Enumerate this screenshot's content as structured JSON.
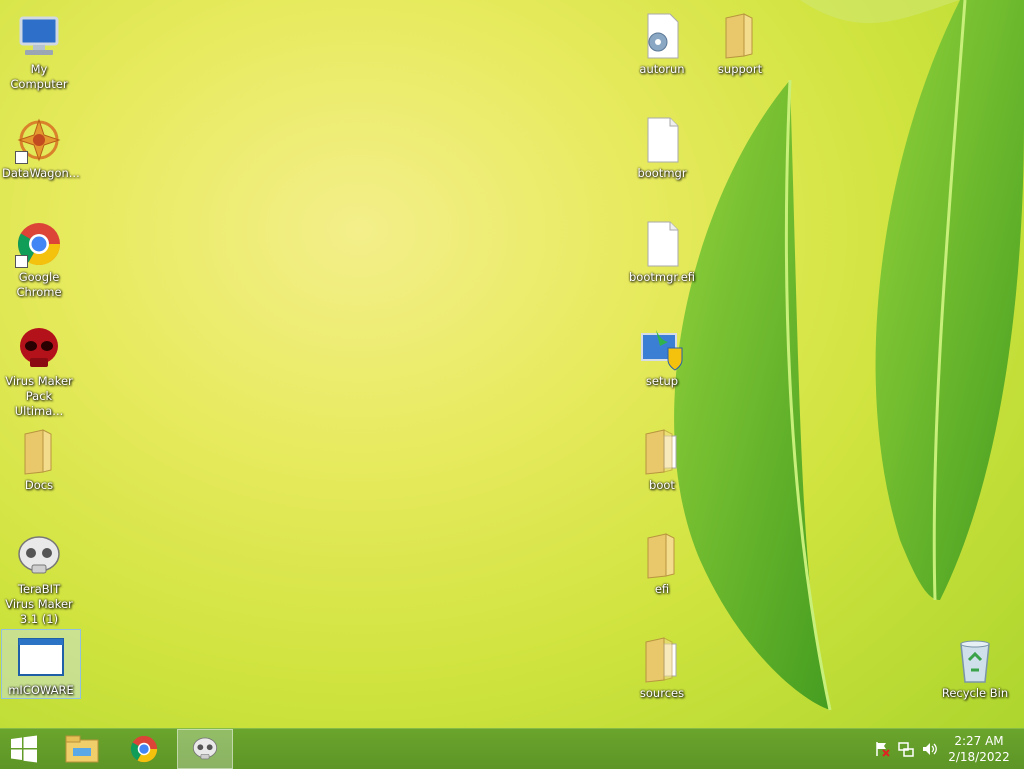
{
  "desktop": {
    "left_icons": [
      {
        "label": "My Computer",
        "icon": "computer-icon"
      },
      {
        "label": "DataWagon...",
        "icon": "datawagon-icon"
      },
      {
        "label": "Google Chrome",
        "icon": "chrome-icon"
      },
      {
        "label": "Virus Maker Pack Ultima...",
        "icon": "red-skull-icon"
      },
      {
        "label": "Docs",
        "icon": "folder-icon"
      },
      {
        "label": "TeraBIT Virus Maker 3.1 (1)",
        "icon": "skull-icon"
      },
      {
        "label": "mICOWARE",
        "icon": "window-icon"
      }
    ],
    "right_icons": [
      {
        "label": "autorun",
        "icon": "settings-file-icon"
      },
      {
        "label": "support",
        "icon": "folder-icon"
      },
      {
        "label": "bootmgr",
        "icon": "file-icon"
      },
      {
        "label": "bootmgr.efi",
        "icon": "file-icon"
      },
      {
        "label": "setup",
        "icon": "setup-icon"
      },
      {
        "label": "boot",
        "icon": "folder-icon"
      },
      {
        "label": "efi",
        "icon": "folder-icon"
      },
      {
        "label": "sources",
        "icon": "folder-icon"
      },
      {
        "label": "Recycle Bin",
        "icon": "recycle-bin-icon"
      }
    ]
  },
  "taskbar": {
    "pinned": [
      "start-icon",
      "file-explorer-icon",
      "chrome-icon",
      "terabit-app-icon"
    ],
    "clock": {
      "time": "2:27 AM",
      "date": "2/18/2022"
    },
    "tray_icons": [
      "action-center-flag-icon",
      "network-icon",
      "volume-icon"
    ]
  },
  "colors": {
    "taskbar": "#6aa52c",
    "wallpaper": "#dfe84e"
  }
}
